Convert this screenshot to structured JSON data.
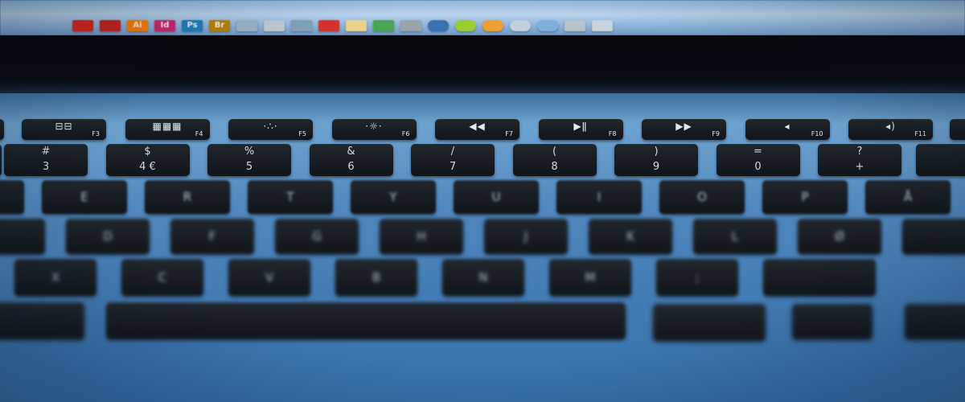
{
  "dock": {
    "icons": [
      {
        "name": "acrobat-icon",
        "label": "",
        "color": "#d8271c",
        "round": false
      },
      {
        "name": "acrobat-reader-icon",
        "label": "",
        "color": "#c8241a",
        "round": false
      },
      {
        "name": "illustrator-icon",
        "label": "Ai",
        "color": "#ff7c00",
        "round": false
      },
      {
        "name": "indesign-icon",
        "label": "Id",
        "color": "#d0246d",
        "round": false
      },
      {
        "name": "photoshop-icon",
        "label": "Ps",
        "color": "#1c7ec1",
        "round": false
      },
      {
        "name": "bridge-icon",
        "label": "Br",
        "color": "#b98100",
        "round": false
      },
      {
        "name": "finder-icon",
        "label": "",
        "color": "#9cb3c8",
        "round": false
      },
      {
        "name": "mail-icon",
        "label": "",
        "color": "#c0cad4",
        "round": false
      },
      {
        "name": "preview-icon",
        "label": "",
        "color": "#7fa2b8",
        "round": false
      },
      {
        "name": "calendar-icon",
        "label": "",
        "color": "#d6322b",
        "round": false
      },
      {
        "name": "notes-icon",
        "label": "",
        "color": "#e8d28a",
        "round": false
      },
      {
        "name": "numbers-icon",
        "label": "",
        "color": "#4aa553",
        "round": false
      },
      {
        "name": "settings-icon",
        "label": "",
        "color": "#9aa4ad",
        "round": false
      },
      {
        "name": "browser-icon",
        "label": "",
        "color": "#3a6fb0",
        "round": true
      },
      {
        "name": "spotify-icon",
        "label": "",
        "color": "#9acd32",
        "round": true
      },
      {
        "name": "app-orange-icon",
        "label": "",
        "color": "#f0a030",
        "round": true
      },
      {
        "name": "app-silver-icon",
        "label": "",
        "color": "#bfd0de",
        "round": true
      },
      {
        "name": "app-blue-icon",
        "label": "",
        "color": "#7fb0dc",
        "round": true
      },
      {
        "name": "photos-icon",
        "label": "",
        "color": "#b8c4cc",
        "round": false
      },
      {
        "name": "trash-icon",
        "label": "",
        "color": "#c9d3dc",
        "round": false
      }
    ]
  },
  "function_keys": [
    {
      "glyph": "⊟⊟",
      "label": "F3"
    },
    {
      "glyph": "▦▦▦",
      "label": "F4"
    },
    {
      "glyph": "·∴·",
      "label": "F5"
    },
    {
      "glyph": "·☼·",
      "label": "F6"
    },
    {
      "glyph": "◀◀",
      "label": "F7"
    },
    {
      "glyph": "▶ǁ",
      "label": "F8"
    },
    {
      "glyph": "▶▶",
      "label": "F9"
    },
    {
      "glyph": "◂",
      "label": "F10"
    },
    {
      "glyph": "◂)",
      "label": "F11"
    }
  ],
  "number_keys": [
    {
      "top": "#",
      "bottom": "3"
    },
    {
      "top": "$",
      "bottom": "4 €"
    },
    {
      "top": "%",
      "bottom": "5"
    },
    {
      "top": "&",
      "bottom": "6"
    },
    {
      "top": "/",
      "bottom": "7"
    },
    {
      "top": "(",
      "bottom": "8"
    },
    {
      "top": ")",
      "bottom": "9"
    },
    {
      "top": "=",
      "bottom": "0"
    },
    {
      "top": "?",
      "bottom": "+"
    }
  ],
  "letter_rows": [
    [
      "E",
      "R",
      "T",
      "Y",
      "U",
      "I",
      "O",
      "P",
      "Å"
    ],
    [
      "D",
      "F",
      "G",
      "H",
      "J",
      "K",
      "L",
      "Ø"
    ],
    [
      "X",
      "C",
      "V",
      "B",
      "N",
      "M",
      ";"
    ]
  ]
}
